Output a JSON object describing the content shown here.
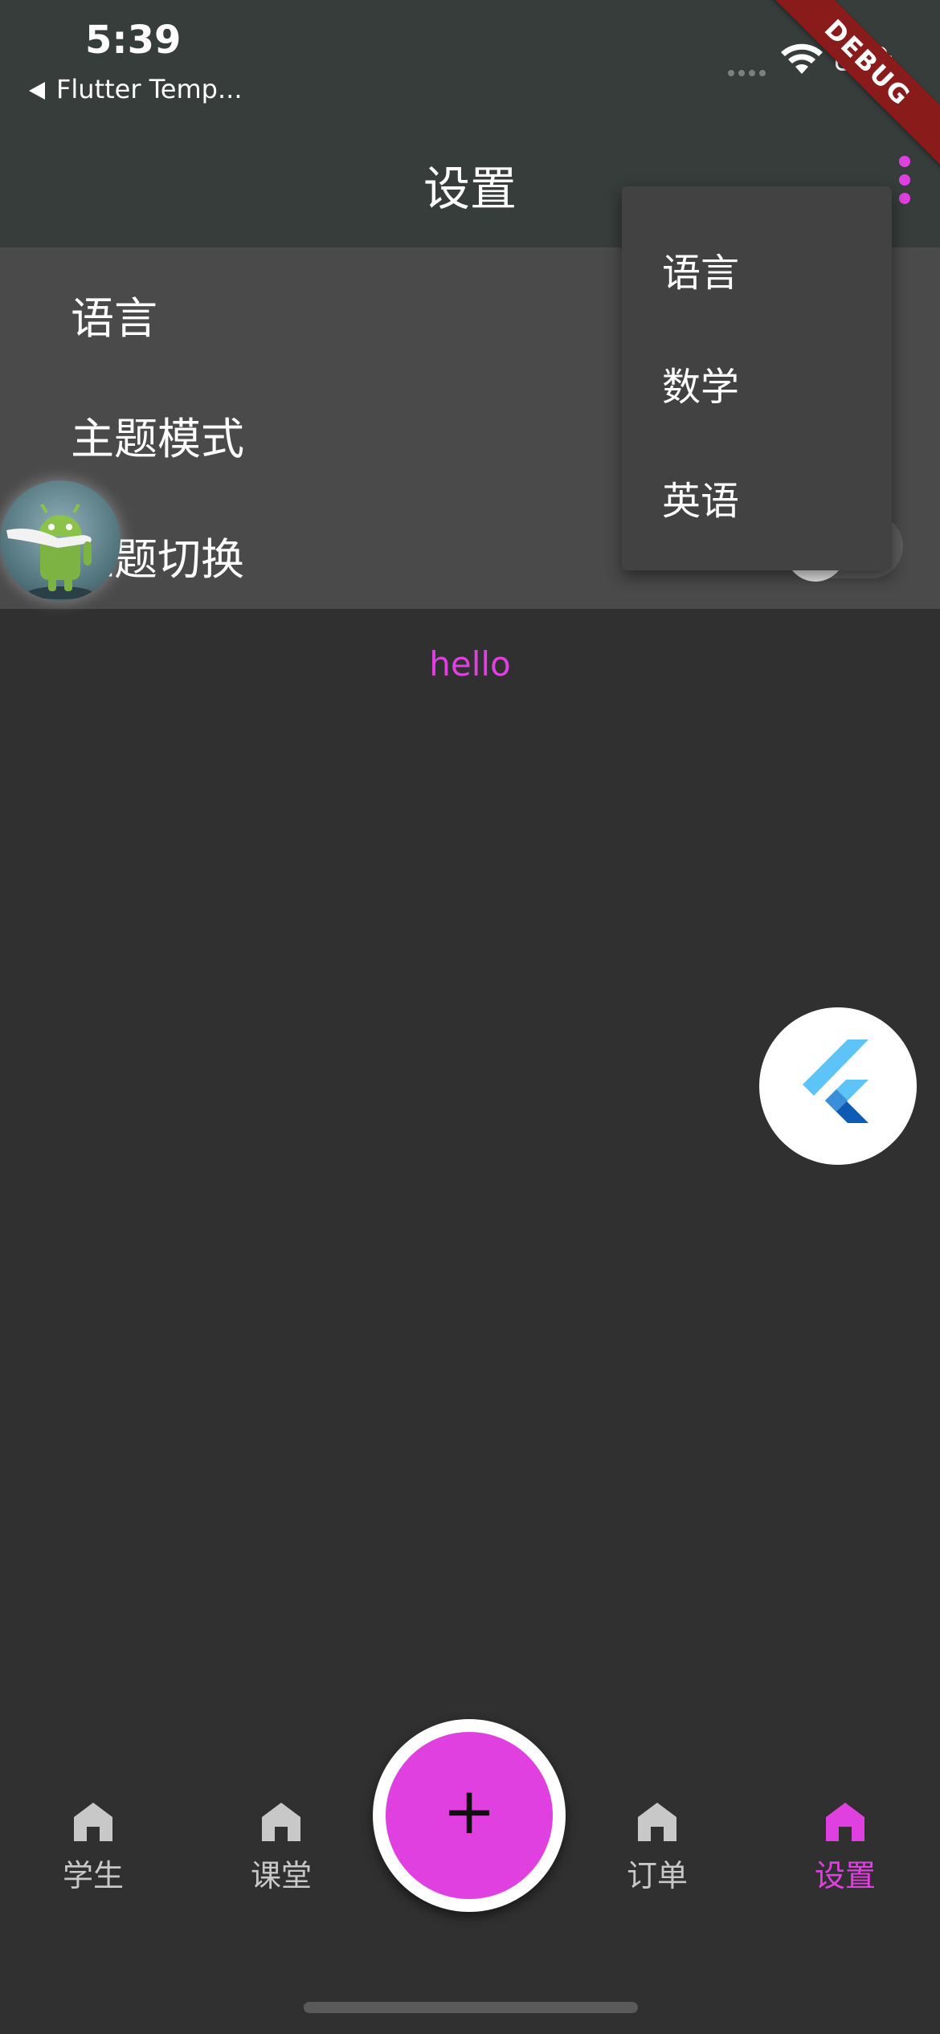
{
  "status_bar": {
    "time": "5:39",
    "back_app": "Flutter Temp..."
  },
  "debug_banner": "DEBUG",
  "app_bar": {
    "title": "设置"
  },
  "settings": {
    "items": [
      {
        "label": "语言"
      },
      {
        "label": "主题模式"
      },
      {
        "label": "主题切换"
      }
    ]
  },
  "popup_menu": {
    "items": [
      {
        "label": "语言"
      },
      {
        "label": "数学"
      },
      {
        "label": "英语"
      }
    ]
  },
  "body": {
    "hello": "hello"
  },
  "fab": {
    "label": "+"
  },
  "bottom_nav": {
    "items": [
      {
        "label": "学生",
        "active": false
      },
      {
        "label": "课堂",
        "active": false
      },
      {
        "label": "订单",
        "active": false
      },
      {
        "label": "设置",
        "active": true
      }
    ]
  },
  "colors": {
    "accent": "#e040e0",
    "appbar": "#363d3b",
    "background": "#303030",
    "panel": "#4a4a4a",
    "menu": "#424242",
    "inactive": "#c8c8c8"
  }
}
